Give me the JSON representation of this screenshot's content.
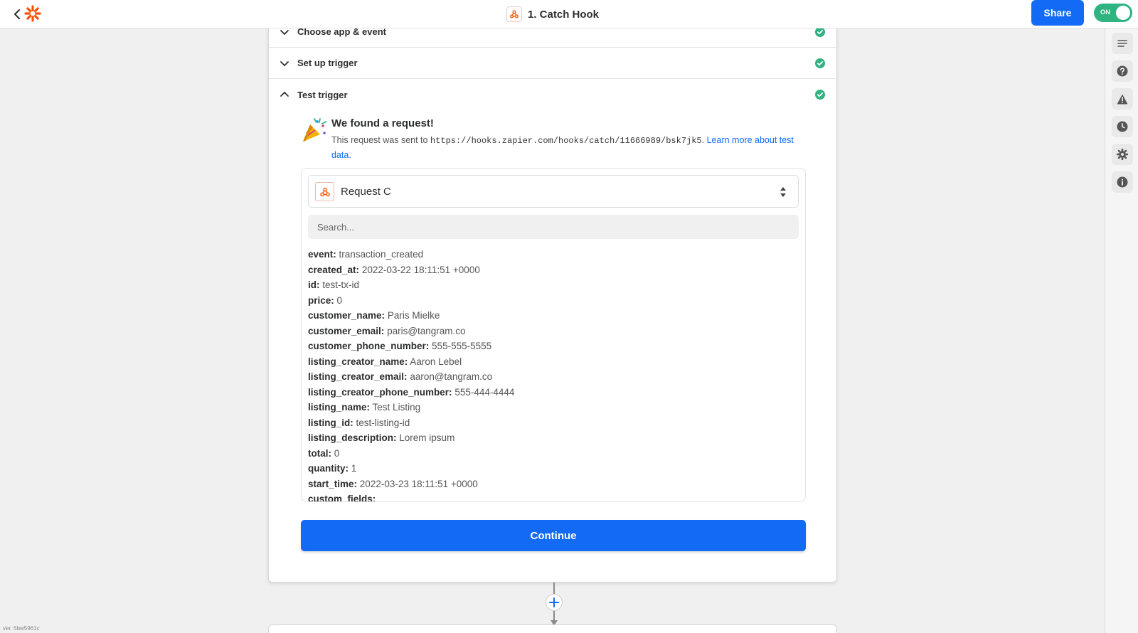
{
  "header": {
    "title": "1. Catch Hook",
    "share_label": "Share",
    "toggle_label": "ON"
  },
  "colors": {
    "primary": "#136bf5",
    "success": "#2fb380",
    "brand": "#ff4f00"
  },
  "icons": {
    "back": "chevron-left-icon",
    "logo": "zapier-logo-icon",
    "webhook": "webhook-icon",
    "party": "party-popper-icon"
  },
  "sections": [
    {
      "label": "Choose app & event",
      "expanded": false,
      "complete": true
    },
    {
      "label": "Set up trigger",
      "expanded": false,
      "complete": true
    },
    {
      "label": "Test trigger",
      "expanded": true,
      "complete": true
    }
  ],
  "test": {
    "found_title": "We found a request!",
    "desc_prefix": "This request was sent to",
    "url": "https://hooks.zapier.com/hooks/catch/11666989/bsk7jk5",
    "desc_period": ".",
    "learn_more": "Learn more about test data.",
    "request_label": "Request C",
    "search_placeholder": "Search...",
    "fields": [
      {
        "key": "event:",
        "value": "transaction_created"
      },
      {
        "key": "created_at:",
        "value": "2022-03-22 18:11:51 +0000"
      },
      {
        "key": "id:",
        "value": "test-tx-id"
      },
      {
        "key": "price:",
        "value": "0"
      },
      {
        "key": "customer_name:",
        "value": "Paris Mielke"
      },
      {
        "key": "customer_email:",
        "value": "paris@tangram.co"
      },
      {
        "key": "customer_phone_number:",
        "value": "555-555-5555"
      },
      {
        "key": "listing_creator_name:",
        "value": "Aaron Lebel"
      },
      {
        "key": "listing_creator_email:",
        "value": "aaron@tangram.co"
      },
      {
        "key": "listing_creator_phone_number:",
        "value": "555-444-4444"
      },
      {
        "key": "listing_name:",
        "value": "Test Listing"
      },
      {
        "key": "listing_id:",
        "value": "test-listing-id"
      },
      {
        "key": "listing_description:",
        "value": "Lorem ipsum"
      },
      {
        "key": "total:",
        "value": "0"
      },
      {
        "key": "quantity:",
        "value": "1"
      },
      {
        "key": "start_time:",
        "value": "2022-03-23 18:11:51 +0000"
      },
      {
        "key": "custom_fields:",
        "value": ""
      }
    ],
    "continue_label": "Continue"
  },
  "rail": [
    {
      "name": "outline-icon"
    },
    {
      "name": "help-icon"
    },
    {
      "name": "warning-icon"
    },
    {
      "name": "history-icon"
    },
    {
      "name": "settings-icon"
    },
    {
      "name": "info-icon"
    }
  ],
  "version": "ver. 5bw5961c"
}
